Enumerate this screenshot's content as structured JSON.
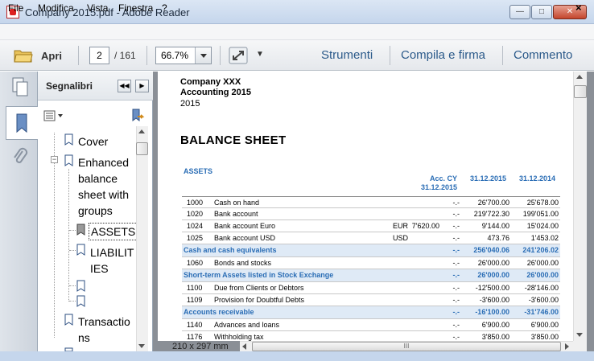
{
  "window": {
    "title": "Company 2015.pdf - Adobe Reader",
    "min": "—",
    "max": "□",
    "close": "✕"
  },
  "menu": {
    "items": [
      "File",
      "Modifica",
      "Vista",
      "Finestra",
      "?"
    ],
    "close": "×"
  },
  "toolbar": {
    "open_label": "Apri",
    "page_current": "2",
    "page_total": "/ 161",
    "zoom": "66.7%",
    "more": "▼",
    "tools": "Strumenti",
    "fill_sign": "Compila e firma",
    "comment": "Commento"
  },
  "bookmarks": {
    "title": "Segnalibri",
    "collapse": "◀◀",
    "expand": "▶",
    "items": {
      "cover": "Cover",
      "enhanced_1": "Enhanced",
      "enhanced_2": "balance",
      "enhanced_3": "sheet with",
      "enhanced_4": "groups",
      "assets": "ASSETS",
      "liab_1": "LIABILIT",
      "liab_2": "IES",
      "trans_1": "Transactio",
      "trans_2": "ns"
    },
    "minus": "−"
  },
  "document": {
    "page_size": "210 x 297 mm",
    "scroll_grip": "III",
    "company_line1": "Company XXX",
    "company_line2": "Accounting 2015",
    "year": "2015",
    "title": "BALANCE SHEET",
    "section": "ASSETS",
    "headers": {
      "acc_cy_1": "Acc. CY",
      "acc_cy_2": "31.12.2015",
      "y1": "31.12.2015",
      "y2": "31.12.2014"
    },
    "rows": [
      {
        "acc": "1000",
        "desc": "Cash on hand",
        "cur": "",
        "amt": "",
        "cy": "-.-",
        "y1": "26'700.00",
        "y2": "25'678.00",
        "group": false
      },
      {
        "acc": "1020",
        "desc": "Bank account",
        "cur": "",
        "amt": "",
        "cy": "-.-",
        "y1": "219'722.30",
        "y2": "199'051.00",
        "group": false
      },
      {
        "acc": "1024",
        "desc": "Bank account Euro",
        "cur": "EUR",
        "amt": "7'620.00",
        "cy": "-.-",
        "y1": "9'144.00",
        "y2": "15'024.00",
        "group": false
      },
      {
        "acc": "1025",
        "desc": "Bank account USD",
        "cur": "USD",
        "amt": "",
        "cy": "-.-",
        "y1": "473.76",
        "y2": "1'453.02",
        "group": false
      },
      {
        "acc": "Cash and cash equivalents",
        "desc": "",
        "cur": "",
        "amt": "",
        "cy": "-.-",
        "y1": "256'040.06",
        "y2": "241'206.02",
        "group": true
      },
      {
        "acc": "1060",
        "desc": "Bonds and stocks",
        "cur": "",
        "amt": "",
        "cy": "-.-",
        "y1": "26'000.00",
        "y2": "26'000.00",
        "group": false
      },
      {
        "acc": "Short-term Assets listed in Stock Exchange",
        "desc": "",
        "cur": "",
        "amt": "",
        "cy": "-.-",
        "y1": "26'000.00",
        "y2": "26'000.00",
        "group": true
      },
      {
        "acc": "1100",
        "desc": "Due from Clients or Debtors",
        "cur": "",
        "amt": "",
        "cy": "-.-",
        "y1": "-12'500.00",
        "y2": "-28'146.00",
        "group": false
      },
      {
        "acc": "1109",
        "desc": "Provision for Doubtful Debts",
        "cur": "",
        "amt": "",
        "cy": "-.-",
        "y1": "-3'600.00",
        "y2": "-3'600.00",
        "group": false
      },
      {
        "acc": "Accounts receivable",
        "desc": "",
        "cur": "",
        "amt": "",
        "cy": "-.-",
        "y1": "-16'100.00",
        "y2": "-31'746.00",
        "group": true
      },
      {
        "acc": "1140",
        "desc": "Advances and loans",
        "cur": "",
        "amt": "",
        "cy": "-.-",
        "y1": "6'900.00",
        "y2": "6'900.00",
        "group": false
      },
      {
        "acc": "1176",
        "desc": "Withholding tax",
        "cur": "",
        "amt": "",
        "cy": "-.-",
        "y1": "3'850.00",
        "y2": "3'850.00",
        "group": false
      }
    ]
  },
  "colors": {
    "accent_blue": "#2a6db5",
    "group_fill": "#dfeaf6",
    "link_blue": "#2b5a8a"
  }
}
